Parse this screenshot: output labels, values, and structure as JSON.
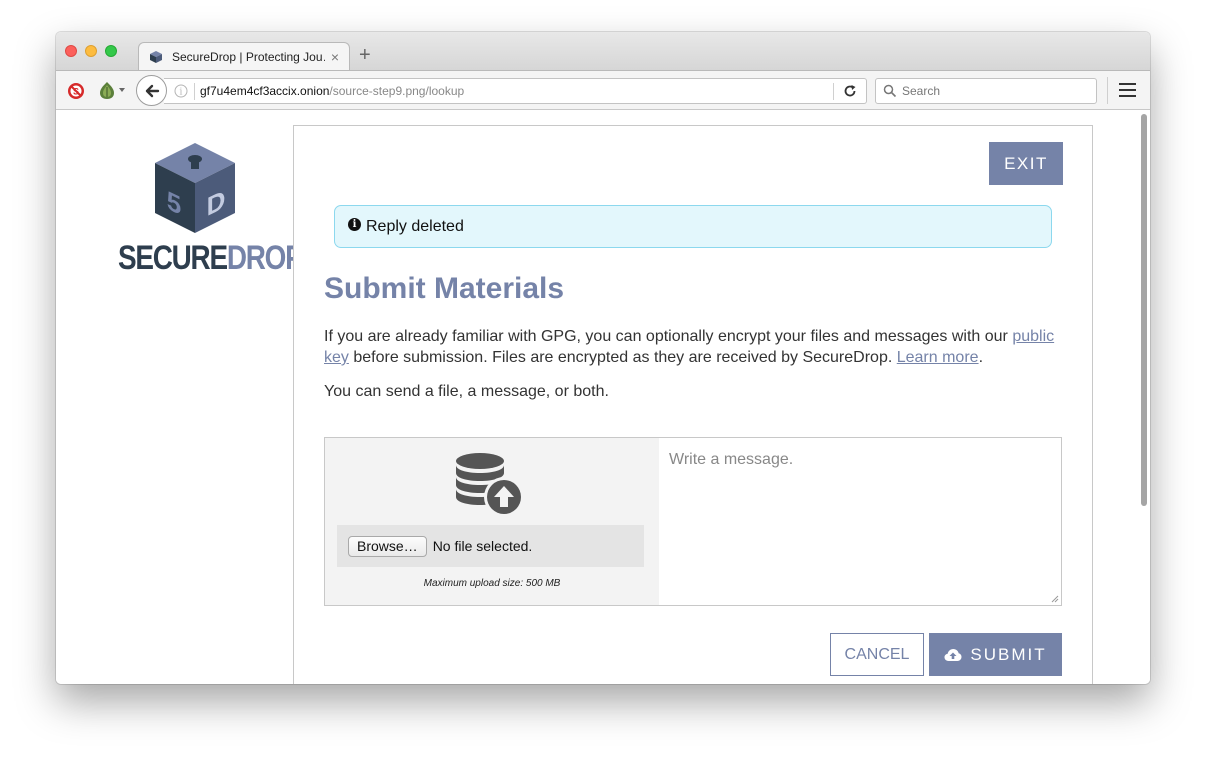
{
  "browser": {
    "tab_title": "SecureDrop | Protecting Jou…",
    "tab_close": "×",
    "new_tab": "+",
    "url_host": "gf7u4em4cf3accix.onion",
    "url_path": "/source-step9.png/lookup",
    "search_placeholder": "Search"
  },
  "logo": {
    "secure": "SECURE",
    "drop": "DROP"
  },
  "page": {
    "exit_label": "EXIT",
    "alert_icon": "i",
    "alert_text": "Reply deleted",
    "title": "Submit Materials",
    "intro_1": "If you are already familiar with GPG, you can optionally encrypt your files and messages with our ",
    "public_key_link": "public key",
    "intro_2": " before submission. Files are encrypted as they are received by SecureDrop. ",
    "learn_more_link": "Learn more",
    "intro_3": ".",
    "send_note": "You can send a file, a message, or both.",
    "browse_label": "Browse…",
    "file_status": "No file selected.",
    "max_upload": "Maximum upload size: 500 MB",
    "message_placeholder": "Write a message.",
    "cancel_label": "CANCEL",
    "submit_label": "SUBMIT"
  },
  "colors": {
    "accent": "#7583a8",
    "dark_slate": "#2e3e4e",
    "alert_bg": "#e3f7fc",
    "alert_border": "#8cd8ee"
  },
  "icons": [
    "noscript-icon",
    "onion-icon",
    "back-arrow-icon",
    "info-icon",
    "reload-icon",
    "search-icon",
    "hamburger-menu-icon",
    "securedrop-cube-logo",
    "database-upload-icon",
    "cloud-upload-icon"
  ]
}
